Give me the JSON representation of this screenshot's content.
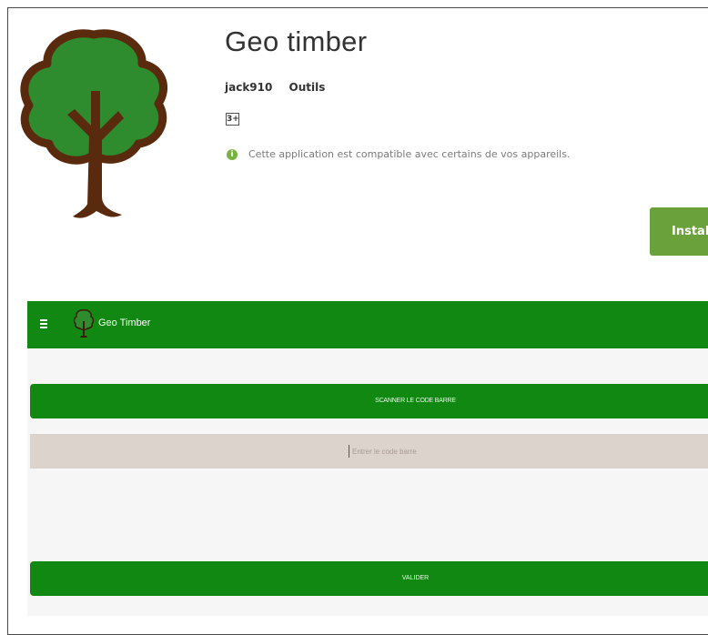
{
  "store": {
    "app_title": "Geo timber",
    "developer": "jack910",
    "category": "Outils",
    "content_rating": "3+",
    "compatibility_text": "Cette application est compatible avec certains de vos appareils.",
    "install_label": "Installer"
  },
  "app_screen": {
    "toolbar_title": "Geo Timber",
    "scan_button_label": "SCANNER LE CODE BARRE",
    "barcode_placeholder": "Entrer le code barre",
    "validate_button_label": "VALIDER"
  },
  "colors": {
    "toolbar_green": "#118811",
    "install_green": "#6aa13a",
    "info_green": "#79b33f",
    "input_beige": "#dcd4cc",
    "tree_brown": "#5a2a0e",
    "tree_green": "#2e8b2e"
  },
  "icons": {
    "app_icon": "tree-icon",
    "menu": "hamburger-menu-icon",
    "info": "info-icon"
  }
}
